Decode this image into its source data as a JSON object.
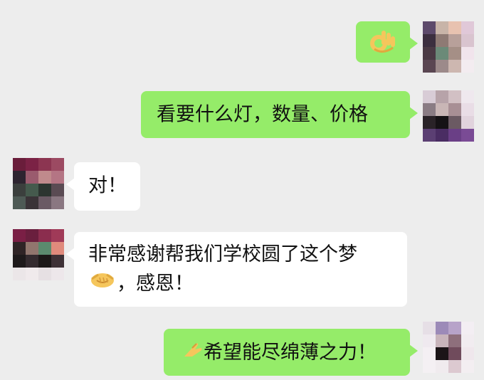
{
  "messages": [
    {
      "sender": "me",
      "emoji_icon": "ok-hand-icon",
      "text": ""
    },
    {
      "sender": "me",
      "text": "看要什么灯，数量、价格"
    },
    {
      "sender": "other",
      "text": "对！"
    },
    {
      "sender": "other",
      "text_line1": "非常感谢帮我们学校圆了这个梦",
      "emoji_icon": "handshake-icon",
      "text_line2": "，感恩！"
    },
    {
      "sender": "me",
      "emoji_icon": "pinching-hand-icon",
      "text": "希望能尽绵薄之力！"
    }
  ],
  "colors": {
    "background": "#ededed",
    "my_bubble": "#95ec69",
    "their_bubble": "#ffffff",
    "emoji_yellow": "#f5c65c"
  }
}
